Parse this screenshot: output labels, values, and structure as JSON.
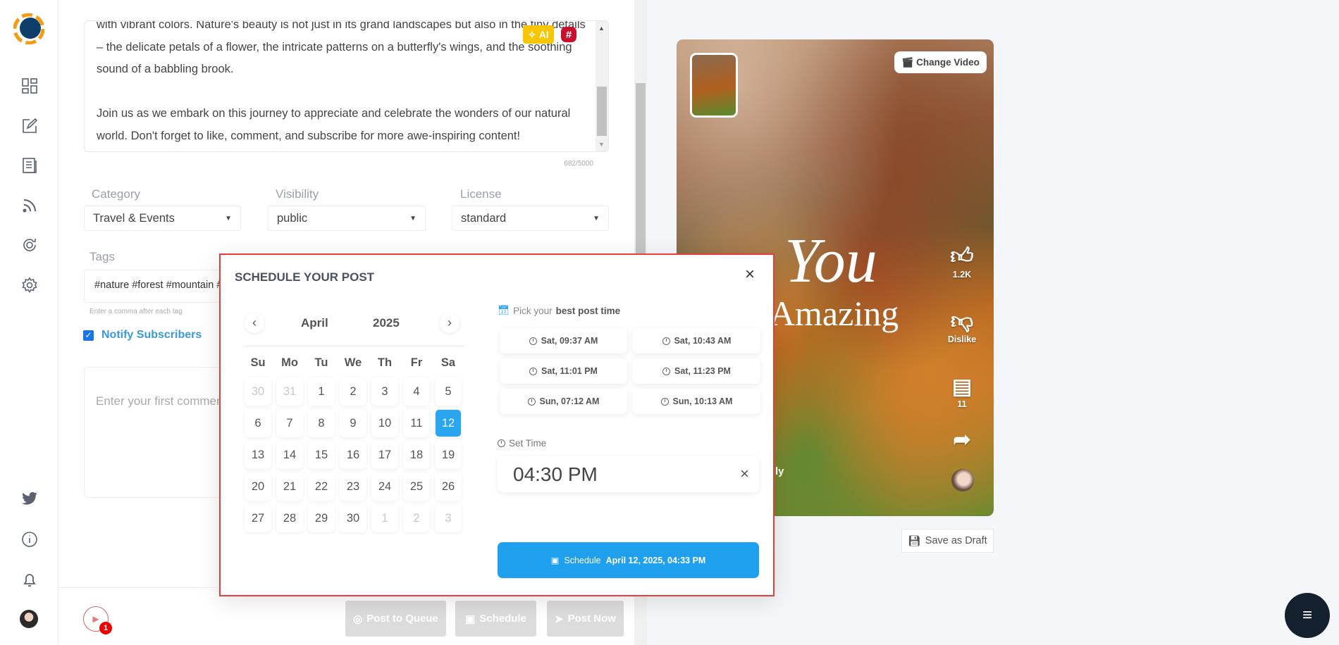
{
  "sidebar": {
    "items": [
      "dashboard-icon",
      "compose-icon",
      "posts-icon",
      "feed-icon",
      "queue-icon",
      "settings-icon"
    ],
    "bottom": [
      "twitter-icon",
      "info-icon",
      "bell-icon",
      "avatar"
    ]
  },
  "editor": {
    "description": "with vibrant colors. Nature's beauty is not just in its grand landscapes but also in the tiny details – the delicate petals of a flower, the intricate patterns on a butterfly's wings, and the soothing sound of a babbling brook.\n\nJoin us as we embark on this journey to appreciate and celebrate the wonders of our natural world. Don't forget to like, comment, and subscribe for more awe-inspiring content!",
    "ai_label": "AI",
    "char_count": "682/5000",
    "category_label": "Category",
    "category_value": "Travel & Events",
    "visibility_label": "Visibility",
    "visibility_value": "public",
    "license_label": "License",
    "license_value": "standard",
    "tags_label": "Tags",
    "tags_value": "#nature #forest #mountain #",
    "tags_hint": "Enter a comma after each tag",
    "notify_label": "Notify Subscribers",
    "notify_checked": true,
    "comment_placeholder": "Enter your first comment"
  },
  "footer": {
    "badge_count": "1",
    "post_to_queue": "Post to Queue",
    "schedule": "Schedule",
    "post_now": "Post Now"
  },
  "modal": {
    "title": "SCHEDULE YOUR POST",
    "month": "April",
    "year": "2025",
    "weekdays": [
      "Su",
      "Mo",
      "Tu",
      "We",
      "Th",
      "Fr",
      "Sa"
    ],
    "weeks": [
      [
        "30",
        "31",
        "1",
        "2",
        "3",
        "4",
        "5"
      ],
      [
        "6",
        "7",
        "8",
        "9",
        "10",
        "11",
        "12"
      ],
      [
        "13",
        "14",
        "15",
        "16",
        "17",
        "18",
        "19"
      ],
      [
        "20",
        "21",
        "22",
        "23",
        "24",
        "25",
        "26"
      ],
      [
        "27",
        "28",
        "29",
        "30",
        "1",
        "2",
        "3"
      ]
    ],
    "selected_day": "12",
    "pick_label": "Pick your",
    "pick_bold": "best post time",
    "best_times": [
      "Sat, 09:37 AM",
      "Sat, 10:43 AM",
      "Sat, 11:01 PM",
      "Sat, 11:23 PM",
      "Sun, 07:12 AM",
      "Sun, 10:13 AM"
    ],
    "set_time_label": "Set Time",
    "time_value": "04:30 PM",
    "schedule_label": "Schedule",
    "schedule_value": "April 12, 2025, 04:33 PM",
    "accent": "#2aa5f0"
  },
  "preview": {
    "change_video": "Change Video",
    "overlay_line1": "You",
    "overlay_line2": "e Amazing",
    "channel_fragment": "ly",
    "likes": "1.2K",
    "dislike": "Dislike",
    "comments": "11",
    "save_draft": "Save as Draft"
  }
}
